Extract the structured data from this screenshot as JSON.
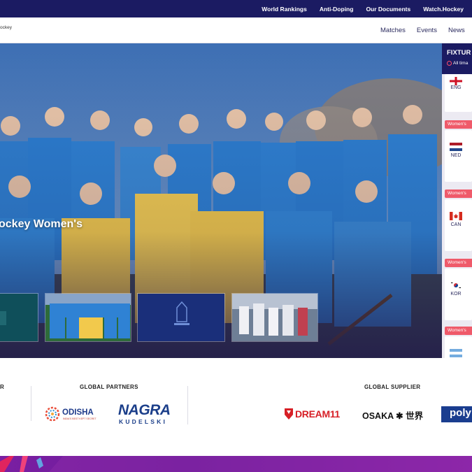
{
  "topbar": {
    "links": [
      "World Rankings",
      "Anti-Doping",
      "Our Documents",
      "Watch.Hockey"
    ]
  },
  "nav": {
    "logo_text": "ockey",
    "items": [
      "Matches",
      "Events",
      "News"
    ]
  },
  "hero": {
    "title": "ockey Women's"
  },
  "fixtures": {
    "title": "FIXTUR",
    "subtitle": "All tima",
    "cards": [
      {
        "badge": "",
        "country": "ENG"
      },
      {
        "badge": "Women's",
        "country": "NED"
      },
      {
        "badge": "Women's",
        "country": "CAN"
      },
      {
        "badge": "Women's",
        "country": "KOR"
      },
      {
        "badge": "Women's",
        "country": ""
      }
    ]
  },
  "partners": {
    "left_heading": "R",
    "global_partners_heading": "GLOBAL PARTNERS",
    "global_supplier_heading": "GLOBAL SUPPLIER",
    "odisha": {
      "name": "ODISHA",
      "tagline": "INDIA'S BEST KEPT SECRET"
    },
    "nagra": {
      "name": "NAGRA",
      "tagline": "KUDELSKI"
    },
    "dream11": "DREAM11",
    "osaka": "OSAKA ✱ 世界",
    "poly": "poly"
  },
  "colors": {
    "navy": "#1b1b62",
    "accent_red": "#ef5a6a",
    "purple_strip": "#7a1fa2"
  }
}
